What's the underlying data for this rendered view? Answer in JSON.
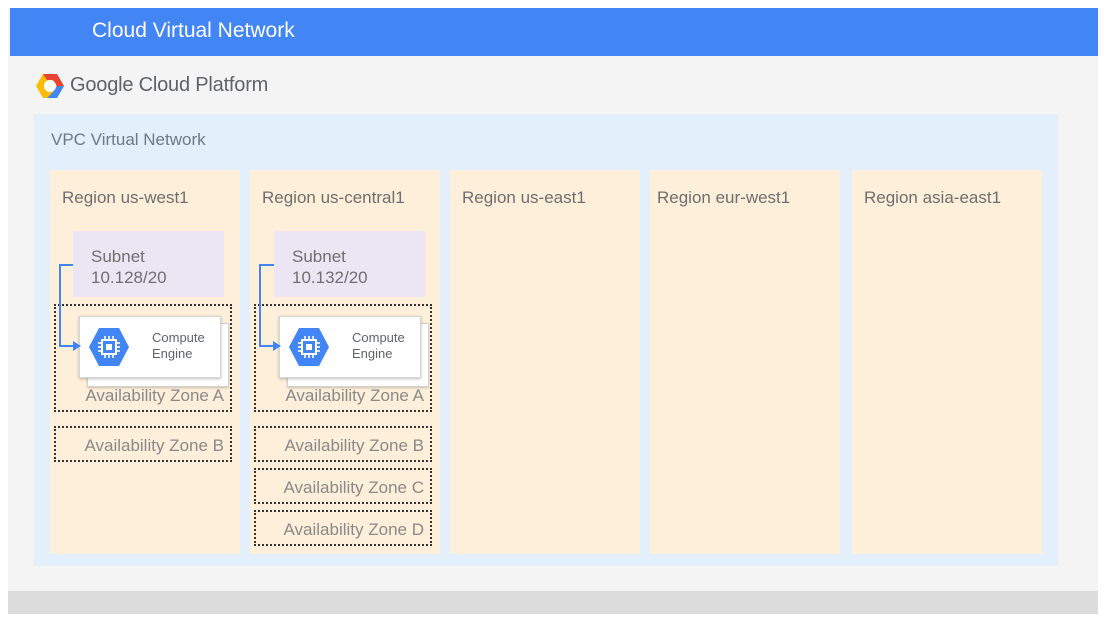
{
  "header": {
    "title": "Cloud Virtual Network"
  },
  "brand": {
    "wordmark": "Google Cloud Platform"
  },
  "vpc": {
    "label": "VPC Virtual Network"
  },
  "regions": [
    {
      "label": "Region us-west1",
      "subnet": {
        "line1": "Subnet",
        "line2": "10.128/20"
      },
      "compute": {
        "line1": "Compute",
        "line2": "Engine"
      },
      "zones": [
        "Availability Zone A",
        "Availability Zone B"
      ]
    },
    {
      "label": "Region us-central1",
      "subnet": {
        "line1": "Subnet",
        "line2": "10.132/20"
      },
      "compute": {
        "line1": "Compute",
        "line2": "Engine"
      },
      "zones": [
        "Availability Zone A",
        "Availability Zone B",
        "Availability Zone C",
        "Availability Zone D"
      ]
    },
    {
      "label": "Region us-east1"
    },
    {
      "label": "Region eur-west1"
    },
    {
      "label": "Region asia-east1"
    }
  ],
  "colors": {
    "header": "#4285f4",
    "vpc_background": "#e3f0fb",
    "region_background": "#fdefd9",
    "subnet_background": "#ece5f3",
    "arrow": "#4285f4",
    "compute_icon": "#4285f4"
  },
  "icons": {
    "logo": "google-cloud-hexagon-logo",
    "compute": "compute-engine-chip-icon"
  }
}
